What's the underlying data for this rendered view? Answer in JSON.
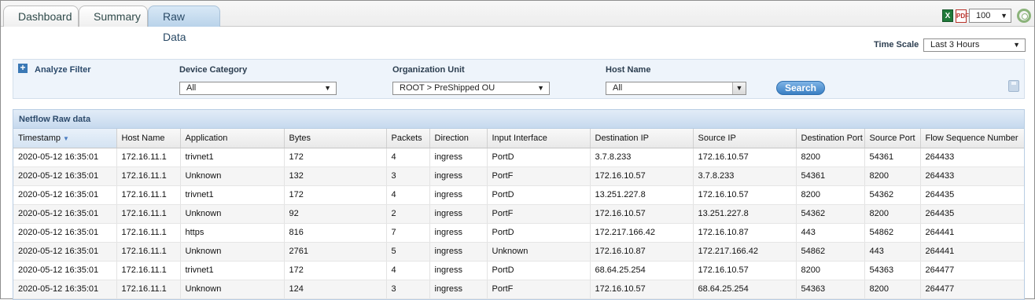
{
  "tabs": [
    {
      "label": "Dashboard",
      "active": false
    },
    {
      "label": "Summary",
      "active": false
    },
    {
      "label": "Raw Data",
      "active": true
    }
  ],
  "toolbar": {
    "excel_icon": "excel-export-icon",
    "pdf_icon": "pdf-export-icon",
    "page_size": "100",
    "settings_icon": "gear-icon"
  },
  "timescale": {
    "label": "Time Scale",
    "value": "Last 3 Hours"
  },
  "filter": {
    "analyze_label": "Analyze Filter",
    "device_category": {
      "label": "Device Category",
      "value": "All"
    },
    "organization_unit": {
      "label": "Organization Unit",
      "value": "ROOT > PreShipped OU"
    },
    "host_name": {
      "label": "Host Name",
      "value": "All"
    },
    "search_label": "Search"
  },
  "grid": {
    "title": "Netflow Raw data",
    "columns": [
      "Timestamp",
      "Host Name",
      "Application",
      "Bytes",
      "Packets",
      "Direction",
      "Input Interface",
      "Destination IP",
      "Source IP",
      "Destination Port",
      "Source Port",
      "Flow Sequence Number"
    ],
    "rows": [
      [
        "2020-05-12 16:35:01",
        "172.16.11.1",
        "trivnet1",
        "172",
        "4",
        "ingress",
        "PortD",
        "3.7.8.233",
        "172.16.10.57",
        "8200",
        "54361",
        "264433"
      ],
      [
        "2020-05-12 16:35:01",
        "172.16.11.1",
        "Unknown",
        "132",
        "3",
        "ingress",
        "PortF",
        "172.16.10.57",
        "3.7.8.233",
        "54361",
        "8200",
        "264433"
      ],
      [
        "2020-05-12 16:35:01",
        "172.16.11.1",
        "trivnet1",
        "172",
        "4",
        "ingress",
        "PortD",
        "13.251.227.8",
        "172.16.10.57",
        "8200",
        "54362",
        "264435"
      ],
      [
        "2020-05-12 16:35:01",
        "172.16.11.1",
        "Unknown",
        "92",
        "2",
        "ingress",
        "PortF",
        "172.16.10.57",
        "13.251.227.8",
        "54362",
        "8200",
        "264435"
      ],
      [
        "2020-05-12 16:35:01",
        "172.16.11.1",
        "https",
        "816",
        "7",
        "ingress",
        "PortD",
        "172.217.166.42",
        "172.16.10.87",
        "443",
        "54862",
        "264441"
      ],
      [
        "2020-05-12 16:35:01",
        "172.16.11.1",
        "Unknown",
        "2761",
        "5",
        "ingress",
        "Unknown",
        "172.16.10.87",
        "172.217.166.42",
        "54862",
        "443",
        "264441"
      ],
      [
        "2020-05-12 16:35:01",
        "172.16.11.1",
        "trivnet1",
        "172",
        "4",
        "ingress",
        "PortD",
        "68.64.25.254",
        "172.16.10.57",
        "8200",
        "54363",
        "264477"
      ],
      [
        "2020-05-12 16:35:01",
        "172.16.11.1",
        "Unknown",
        "124",
        "3",
        "ingress",
        "PortF",
        "172.16.10.57",
        "68.64.25.254",
        "54363",
        "8200",
        "264477"
      ]
    ]
  }
}
